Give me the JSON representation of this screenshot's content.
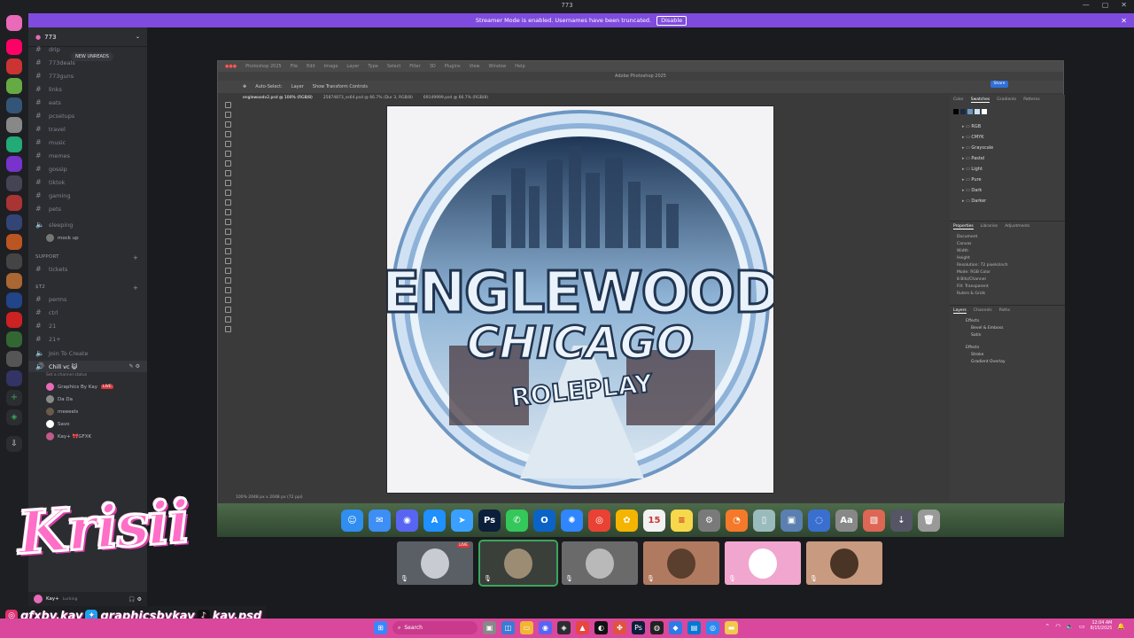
{
  "window": {
    "title": "773",
    "controls": [
      "—",
      "▢",
      "✕"
    ]
  },
  "banner": {
    "text": "Streamer Mode is enabled. Usernames have been truncated.",
    "action": "Disable"
  },
  "server": {
    "name": "773"
  },
  "new_unreads": "NEW UNREADS",
  "channels": [
    {
      "label": "drip",
      "type": "text"
    },
    {
      "label": "773deals",
      "type": "text"
    },
    {
      "label": "773guns",
      "type": "text"
    },
    {
      "label": "links",
      "type": "text"
    },
    {
      "label": "eats",
      "type": "text"
    },
    {
      "label": "pcsetups",
      "type": "text"
    },
    {
      "label": "travel",
      "type": "text"
    },
    {
      "label": "music",
      "type": "text"
    },
    {
      "label": "memes",
      "type": "text"
    },
    {
      "label": "gossip",
      "type": "text"
    },
    {
      "label": "tiktok",
      "type": "text"
    },
    {
      "label": "gaming",
      "type": "text"
    },
    {
      "label": "pets",
      "type": "text"
    }
  ],
  "sleeping": {
    "label": "sleeping",
    "user": "mock up"
  },
  "support_category": "SUPPORT",
  "support_channels": [
    {
      "label": "tickets"
    }
  ],
  "staff_category": "$T2",
  "staff_channels": [
    {
      "label": "perms"
    },
    {
      "label": "ctrl"
    },
    {
      "label": "21"
    },
    {
      "label": "21+"
    }
  ],
  "join_to_create": "Join To Create",
  "voice": {
    "channel": "Chill vc 😺",
    "status": "Set a channel status",
    "users": [
      {
        "name": "Graphics By Kay",
        "live": "LIVE",
        "color": "#e86ab8"
      },
      {
        "name": "Da Da",
        "color": "#8a8a8a"
      },
      {
        "name": "meeeels",
        "color": "#6b5a4a"
      },
      {
        "name": "Savo",
        "color": "#ffffff"
      },
      {
        "name": "Kay+ 🎀GFXK",
        "color": "#c05a8a"
      }
    ]
  },
  "user": {
    "name": "Kay+",
    "status": "Lurking"
  },
  "overlay": {
    "logo_text": "Krisii",
    "socials": [
      {
        "icon": "instagram-icon",
        "handle": "gfxby.kay",
        "color": "#e1306c"
      },
      {
        "icon": "twitter-icon",
        "handle": "graphicsbykay",
        "color": "#1da1f2"
      },
      {
        "icon": "tiktok-icon",
        "handle": "kay.psd",
        "color": "#111111"
      }
    ]
  },
  "photoshop": {
    "app_title": "Adobe Photoshop 2025",
    "menu": [
      "Photoshop 2025",
      "File",
      "Edit",
      "Image",
      "Layer",
      "Type",
      "Select",
      "Filter",
      "3D",
      "Plugins",
      "View",
      "Window",
      "Help"
    ],
    "options": [
      "Auto-Select:",
      "Layer",
      "Show Transform Controls"
    ],
    "tabs": [
      "englewoodv2.psd @ 100% (RGB/8)",
      "25874873_ss64.psd @ 66.7% (Dur 3, RGB/8)",
      "69149999.psd @ 66.7% (RGB/8)"
    ],
    "share": "Share",
    "swatch_tabs": [
      "Color",
      "Swatches",
      "Gradients",
      "Patterns"
    ],
    "swatch_folders": [
      "RGB",
      "CMYK",
      "Grayscale",
      "Pastel",
      "Light",
      "Pure",
      "Dark",
      "Darker"
    ],
    "properties_tabs": [
      "Properties",
      "Libraries",
      "Adjustments"
    ],
    "properties": [
      "Document",
      "Canvas",
      "Width",
      "Height",
      "Resolution: 72 pixels/inch",
      "Mode: RGB Color",
      "8 Bits/Channel",
      "Fill: Transparent",
      "Rulers & Grids"
    ],
    "layers_tabs": [
      "Layers",
      "Channels",
      "Paths"
    ],
    "layers": [
      "Effects",
      "Bevel & Emboss",
      "Satin",
      "Effects",
      "Stroke",
      "Gradient Overlay"
    ],
    "status": "100%   2048 px x 2048 px (72 ppi)"
  },
  "artwork": {
    "line1": "ENGLEWOOD",
    "line2": "CHICAGO",
    "line3": "ROLEPLAY"
  },
  "dock": [
    {
      "name": "finder-icon",
      "glyph": "☺",
      "color": "#2f8ef0"
    },
    {
      "name": "mail-icon",
      "glyph": "✉",
      "color": "#3d8ef5"
    },
    {
      "name": "discord-icon",
      "glyph": "◉",
      "color": "#5865f2"
    },
    {
      "name": "app-store-icon",
      "glyph": "A",
      "color": "#1e90ff"
    },
    {
      "name": "cursor-icon",
      "glyph": "➤",
      "color": "#3aa0ff"
    },
    {
      "name": "photoshop-icon",
      "glyph": "Ps",
      "color": "#0b1e3a"
    },
    {
      "name": "messages-icon",
      "glyph": "✆",
      "color": "#34c759"
    },
    {
      "name": "outlook-icon",
      "glyph": "O",
      "color": "#0a64c8"
    },
    {
      "name": "safari-icon",
      "glyph": "✺",
      "color": "#2f86ff"
    },
    {
      "name": "chrome-icon",
      "glyph": "◎",
      "color": "#e94235"
    },
    {
      "name": "photos-icon",
      "glyph": "✿",
      "color": "#f4b400"
    },
    {
      "name": "calendar-icon",
      "glyph": "15",
      "color": "#f2f2f2"
    },
    {
      "name": "notes-icon",
      "glyph": "≡",
      "color": "#f7d84b"
    },
    {
      "name": "settings-icon",
      "glyph": "⚙",
      "color": "#7a7a7a"
    },
    {
      "name": "blender-icon",
      "glyph": "◔",
      "color": "#f5792a"
    },
    {
      "name": "files-icon",
      "glyph": "▯",
      "color": "#9bb"
    },
    {
      "name": "preview-icon",
      "glyph": "▣",
      "color": "#5a7fb0"
    },
    {
      "name": "screenshot-icon",
      "glyph": "◌",
      "color": "#3a6fd0"
    },
    {
      "name": "font-book-icon",
      "glyph": "Aa",
      "color": "#888"
    },
    {
      "name": "image-app-icon",
      "glyph": "▧",
      "color": "#d65"
    },
    {
      "name": "downloads-icon",
      "glyph": "⇣",
      "color": "#556"
    },
    {
      "name": "trash-icon",
      "glyph": "🗑",
      "color": "#999"
    }
  ],
  "stream_tiles": [
    {
      "live": "LIVE",
      "color": "#5a5f66",
      "face": "#c8ccd2"
    },
    {
      "color": "#3a3f3a",
      "face": "#9c8c74"
    },
    {
      "color": "#6a6a6a",
      "face": "#b9b9b9"
    },
    {
      "color": "#b07a60",
      "face": "#5a3e2e"
    },
    {
      "color": "#f1a6cf",
      "face": "#ffffff"
    },
    {
      "color": "#c89a80",
      "face": "#4a3426"
    }
  ],
  "taskbar": {
    "search": "Search",
    "time": "12:04 AM",
    "date": "8/15/2025"
  }
}
